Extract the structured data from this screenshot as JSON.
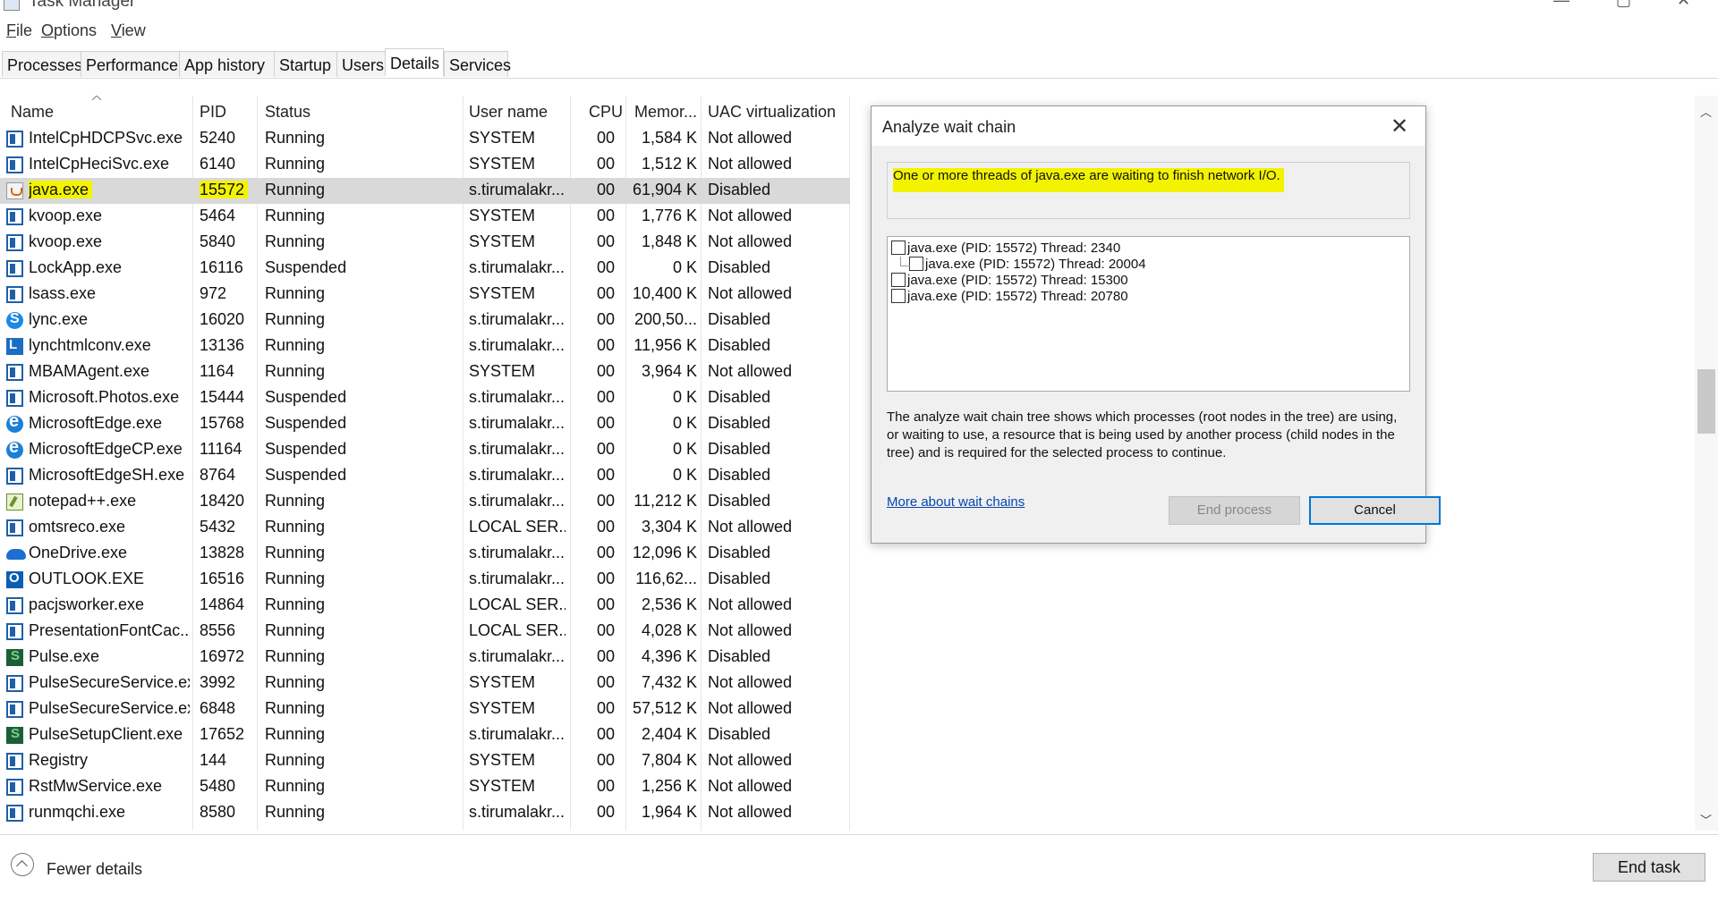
{
  "window": {
    "title": "Task Manager"
  },
  "menu": [
    "File",
    "Options",
    "View"
  ],
  "tabs": [
    {
      "label": "Processes"
    },
    {
      "label": "Performance"
    },
    {
      "label": "App history"
    },
    {
      "label": "Startup"
    },
    {
      "label": "Users"
    },
    {
      "label": "Details",
      "active": true
    },
    {
      "label": "Services"
    }
  ],
  "columns": {
    "name": "Name",
    "pid": "PID",
    "status": "Status",
    "user": "User name",
    "cpu": "CPU",
    "memory": "Memor...",
    "uac": "UAC virtualization"
  },
  "rows": [
    {
      "icon": "default",
      "name": "IntelCpHDCPSvc.exe",
      "pid": "5240",
      "status": "Running",
      "user": "SYSTEM",
      "cpu": "00",
      "mem": "1,584 K",
      "uac": "Not allowed"
    },
    {
      "icon": "default",
      "name": "IntelCpHeciSvc.exe",
      "pid": "6140",
      "status": "Running",
      "user": "SYSTEM",
      "cpu": "00",
      "mem": "1,512 K",
      "uac": "Not allowed"
    },
    {
      "icon": "java",
      "name": "java.exe",
      "pid": "15572",
      "status": "Running",
      "user": "s.tirumalakr...",
      "cpu": "00",
      "mem": "61,904 K",
      "uac": "Disabled",
      "selected": true,
      "highlight": true
    },
    {
      "icon": "default",
      "name": "kvoop.exe",
      "pid": "5464",
      "status": "Running",
      "user": "SYSTEM",
      "cpu": "00",
      "mem": "1,776 K",
      "uac": "Not allowed"
    },
    {
      "icon": "default",
      "name": "kvoop.exe",
      "pid": "5840",
      "status": "Running",
      "user": "SYSTEM",
      "cpu": "00",
      "mem": "1,848 K",
      "uac": "Not allowed"
    },
    {
      "icon": "default",
      "name": "LockApp.exe",
      "pid": "16116",
      "status": "Suspended",
      "user": "s.tirumalakr...",
      "cpu": "00",
      "mem": "0 K",
      "uac": "Disabled"
    },
    {
      "icon": "default",
      "name": "lsass.exe",
      "pid": "972",
      "status": "Running",
      "user": "SYSTEM",
      "cpu": "00",
      "mem": "10,400 K",
      "uac": "Not allowed"
    },
    {
      "icon": "lync",
      "name": "lync.exe",
      "pid": "16020",
      "status": "Running",
      "user": "s.tirumalakr...",
      "cpu": "00",
      "mem": "200,50...",
      "uac": "Disabled"
    },
    {
      "icon": "lyncl",
      "name": "lynchtmlconv.exe",
      "pid": "13136",
      "status": "Running",
      "user": "s.tirumalakr...",
      "cpu": "00",
      "mem": "11,956 K",
      "uac": "Disabled"
    },
    {
      "icon": "default",
      "name": "MBAMAgent.exe",
      "pid": "1164",
      "status": "Running",
      "user": "SYSTEM",
      "cpu": "00",
      "mem": "3,964 K",
      "uac": "Not allowed"
    },
    {
      "icon": "default",
      "name": "Microsoft.Photos.exe",
      "pid": "15444",
      "status": "Suspended",
      "user": "s.tirumalakr...",
      "cpu": "00",
      "mem": "0 K",
      "uac": "Disabled"
    },
    {
      "icon": "edge",
      "name": "MicrosoftEdge.exe",
      "pid": "15768",
      "status": "Suspended",
      "user": "s.tirumalakr...",
      "cpu": "00",
      "mem": "0 K",
      "uac": "Disabled"
    },
    {
      "icon": "edge",
      "name": "MicrosoftEdgeCP.exe",
      "pid": "11164",
      "status": "Suspended",
      "user": "s.tirumalakr...",
      "cpu": "00",
      "mem": "0 K",
      "uac": "Disabled"
    },
    {
      "icon": "default",
      "name": "MicrosoftEdgeSH.exe",
      "pid": "8764",
      "status": "Suspended",
      "user": "s.tirumalakr...",
      "cpu": "00",
      "mem": "0 K",
      "uac": "Disabled"
    },
    {
      "icon": "notepad",
      "name": "notepad++.exe",
      "pid": "18420",
      "status": "Running",
      "user": "s.tirumalakr...",
      "cpu": "00",
      "mem": "11,212 K",
      "uac": "Disabled"
    },
    {
      "icon": "default",
      "name": "omtsreco.exe",
      "pid": "5432",
      "status": "Running",
      "user": "LOCAL SER...",
      "cpu": "00",
      "mem": "3,304 K",
      "uac": "Not allowed"
    },
    {
      "icon": "onedrive",
      "name": "OneDrive.exe",
      "pid": "13828",
      "status": "Running",
      "user": "s.tirumalakr...",
      "cpu": "00",
      "mem": "12,096 K",
      "uac": "Disabled"
    },
    {
      "icon": "outlook",
      "name": "OUTLOOK.EXE",
      "pid": "16516",
      "status": "Running",
      "user": "s.tirumalakr...",
      "cpu": "00",
      "mem": "116,62...",
      "uac": "Disabled"
    },
    {
      "icon": "default",
      "name": "pacjsworker.exe",
      "pid": "14864",
      "status": "Running",
      "user": "LOCAL SER...",
      "cpu": "00",
      "mem": "2,536 K",
      "uac": "Not allowed"
    },
    {
      "icon": "default",
      "name": "PresentationFontCac...",
      "pid": "8556",
      "status": "Running",
      "user": "LOCAL SER...",
      "cpu": "00",
      "mem": "4,028 K",
      "uac": "Not allowed"
    },
    {
      "icon": "pulse",
      "name": "Pulse.exe",
      "pid": "16972",
      "status": "Running",
      "user": "s.tirumalakr...",
      "cpu": "00",
      "mem": "4,396 K",
      "uac": "Disabled"
    },
    {
      "icon": "default",
      "name": "PulseSecureService.exe",
      "pid": "3992",
      "status": "Running",
      "user": "SYSTEM",
      "cpu": "00",
      "mem": "7,432 K",
      "uac": "Not allowed"
    },
    {
      "icon": "default",
      "name": "PulseSecureService.exe",
      "pid": "6848",
      "status": "Running",
      "user": "SYSTEM",
      "cpu": "00",
      "mem": "57,512 K",
      "uac": "Not allowed"
    },
    {
      "icon": "pulse",
      "name": "PulseSetupClient.exe",
      "pid": "17652",
      "status": "Running",
      "user": "s.tirumalakr...",
      "cpu": "00",
      "mem": "2,404 K",
      "uac": "Disabled"
    },
    {
      "icon": "default",
      "name": "Registry",
      "pid": "144",
      "status": "Running",
      "user": "SYSTEM",
      "cpu": "00",
      "mem": "7,804 K",
      "uac": "Not allowed"
    },
    {
      "icon": "default",
      "name": "RstMwService.exe",
      "pid": "5480",
      "status": "Running",
      "user": "SYSTEM",
      "cpu": "00",
      "mem": "1,256 K",
      "uac": "Not allowed"
    },
    {
      "icon": "default",
      "name": "runmqchi.exe",
      "pid": "8580",
      "status": "Running",
      "user": "s.tirumalakr...",
      "cpu": "00",
      "mem": "1,964 K",
      "uac": "Not allowed"
    }
  ],
  "footer": {
    "fewer_details": "Fewer details",
    "end_task": "End task"
  },
  "dialog": {
    "title": "Analyze wait chain",
    "message": "One or more threads of java.exe are waiting to finish network I/O.",
    "chain": [
      {
        "label": "java.exe (PID: 15572) Thread: 2340",
        "level": 0
      },
      {
        "label": "java.exe (PID: 15572) Thread: 20004",
        "level": 1
      },
      {
        "label": "java.exe (PID: 15572) Thread: 15300",
        "level": 0
      },
      {
        "label": "java.exe (PID: 15572) Thread: 20780",
        "level": 0
      }
    ],
    "description": "The analyze wait chain tree shows which processes (root nodes in the tree) are using, or waiting to use, a resource that is being used by another process (child nodes in the tree) and is required for the selected process to continue.",
    "link": "More about wait chains",
    "end_process": "End process",
    "cancel": "Cancel"
  },
  "colors": {
    "highlight": "#f3f300",
    "selected_row": "#d9d9d9",
    "accent": "#0078d7"
  }
}
